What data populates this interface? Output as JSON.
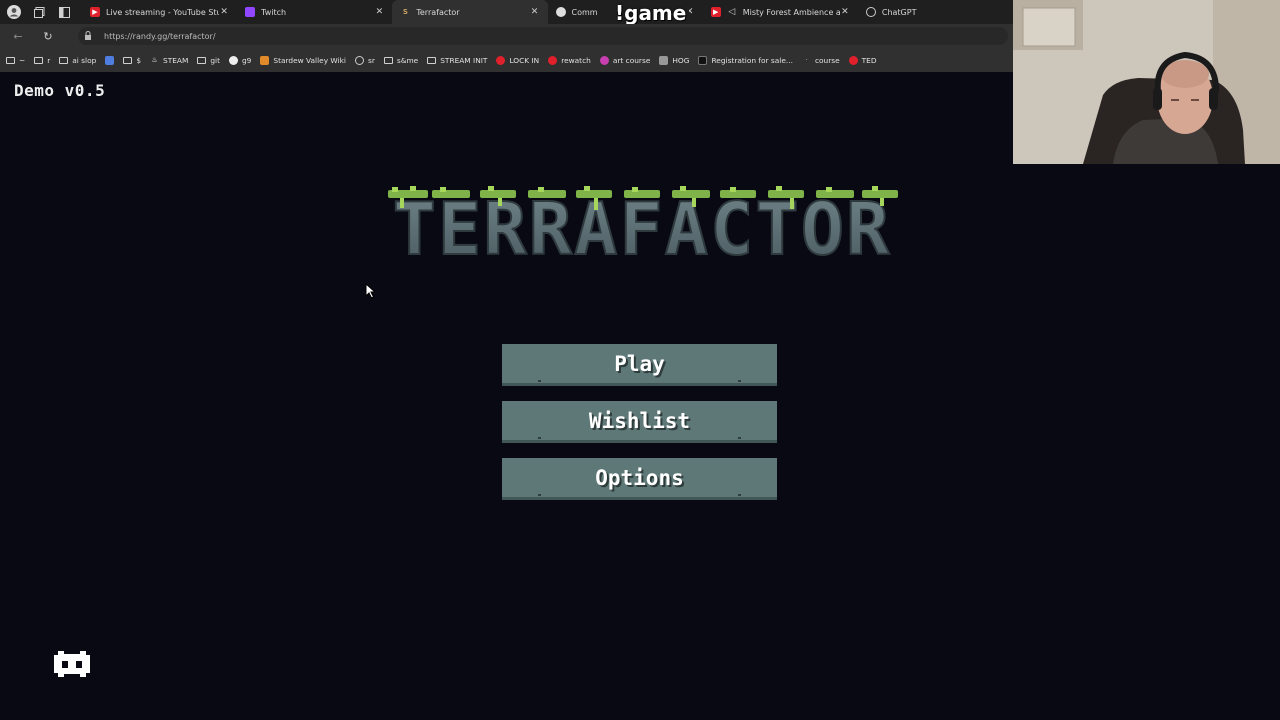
{
  "browser": {
    "tabs": [
      {
        "label": "Live streaming - YouTube Studio",
        "favicon": "youtube-studio-icon",
        "color": "#e0202a",
        "active": false
      },
      {
        "label": "Twitch",
        "favicon": "twitch-icon",
        "color": "#9146ff",
        "active": false
      },
      {
        "label": "Terrafactor",
        "favicon": "terrafactor-icon",
        "color": "#c8a060",
        "active": true
      },
      {
        "label": "Comm",
        "favicon": "community-icon",
        "color": "#ffffff",
        "active": false
      },
      {
        "label": "Misty Forest Ambience and R",
        "favicon": "youtube-icon",
        "color": "#e0202a",
        "active": false
      },
      {
        "label": "ChatGPT",
        "favicon": "chatgpt-icon",
        "color": "#cccccc",
        "active": false
      }
    ],
    "overlay_text": "!game",
    "url": "https://randy.gg/terrafactor/",
    "bookmarks": [
      {
        "label": "~",
        "icon": "folder-icon"
      },
      {
        "label": "r",
        "icon": "folder-icon"
      },
      {
        "label": "ai slop",
        "icon": "folder-icon"
      },
      {
        "label": "",
        "icon": "calendar-icon"
      },
      {
        "label": "$",
        "icon": "folder-icon"
      },
      {
        "label": "STEAM",
        "icon": "steam-icon"
      },
      {
        "label": "git",
        "icon": "folder-icon"
      },
      {
        "label": "g9",
        "icon": "github-icon"
      },
      {
        "label": "Stardew Valley Wiki",
        "icon": "stardew-icon"
      },
      {
        "label": "sr",
        "icon": "web-icon"
      },
      {
        "label": "s&me",
        "icon": "folder-icon"
      },
      {
        "label": "STREAM INIT",
        "icon": "folder-icon"
      },
      {
        "label": "LOCK IN",
        "icon": "youtube-icon"
      },
      {
        "label": "rewatch",
        "icon": "youtube-icon"
      },
      {
        "label": "art course",
        "icon": "art-icon"
      },
      {
        "label": "HOG",
        "icon": "hog-icon"
      },
      {
        "label": "Registration for sale...",
        "icon": "registration-icon"
      },
      {
        "label": "course",
        "icon": "dot-icon"
      },
      {
        "label": "TED",
        "icon": "youtube-icon"
      }
    ]
  },
  "game": {
    "version": "Demo v0.5",
    "title": "TERRAFACTOR",
    "buttons": {
      "play": "Play",
      "wishlist": "Wishlist",
      "options": "Options"
    },
    "discord_icon": "discord-icon",
    "colors": {
      "background": "#090914",
      "button": "#5d7877",
      "logo_stone": "#5b6e73",
      "logo_moss": "#7fb34a"
    }
  }
}
